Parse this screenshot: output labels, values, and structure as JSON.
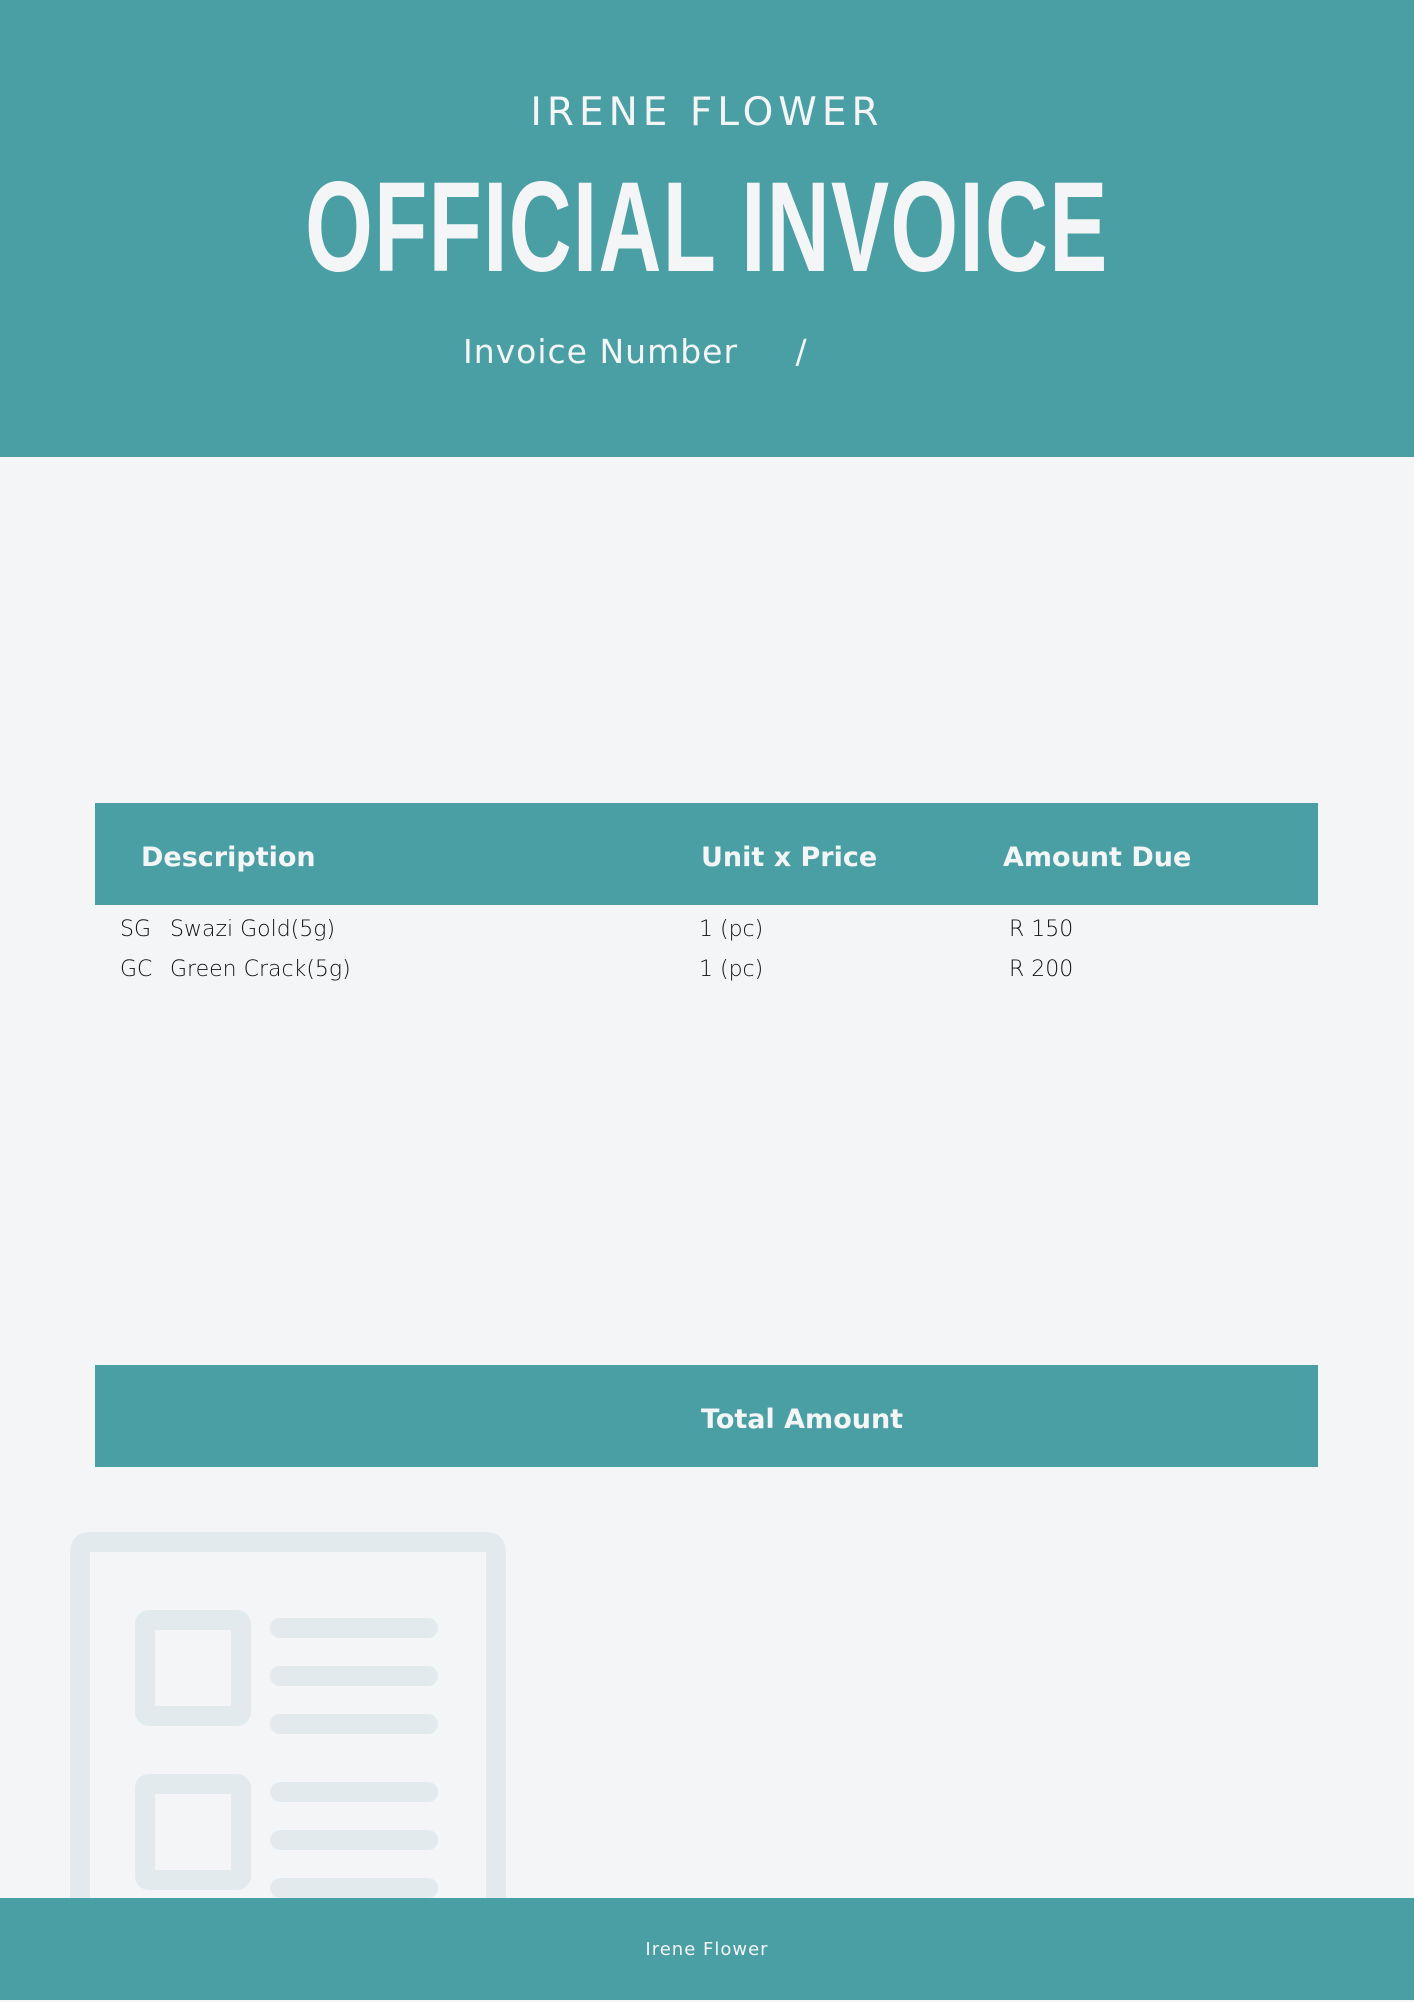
{
  "header": {
    "company": "IRENE FLOWER",
    "title": "OFFICIAL INVOICE",
    "invoice_number_label": "Invoice Number     /"
  },
  "table": {
    "headers": {
      "description": "Description",
      "unit_price": "Unit x Price",
      "amount_due": "Amount Due"
    },
    "rows": [
      {
        "code": "SG",
        "description": "Swazi Gold(5g)",
        "unit": "1 (pc)",
        "amount": "R 150"
      },
      {
        "code": "GC",
        "description": "Green Crack(5g)",
        "unit": "1 (pc)",
        "amount": "R 200"
      }
    ]
  },
  "total": {
    "label": "Total Amount"
  },
  "footer": {
    "text": "Irene Flower"
  },
  "colors": {
    "accent": "#4a9fa5",
    "background": "#f3f5f7",
    "graphic": "#e3eaed"
  },
  "icons": {
    "document_graphic": "document-list-icon"
  }
}
